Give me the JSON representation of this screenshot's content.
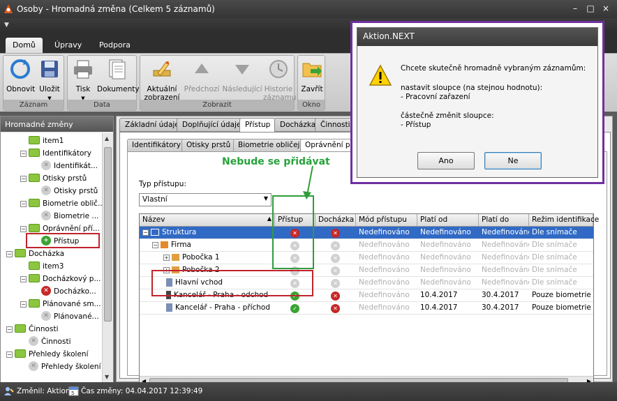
{
  "window": {
    "title": "Osoby - Hromadná změna (Celkem 5 záznamů)",
    "min": "–",
    "max": "□",
    "close": "×"
  },
  "ribbon_tabs": [
    "Domů",
    "Úpravy",
    "Podpora"
  ],
  "ribbon": {
    "groups": [
      "Záznam",
      "Data",
      "Zobrazit",
      "Okno"
    ],
    "buttons": {
      "obnovit": "Obnovit",
      "ulozit": "Uložit",
      "tisk": "Tisk",
      "dokumenty": "Dokumenty",
      "aktualni_1": "Aktuální",
      "aktualni_2": "zobrazení",
      "predchozi": "Předchozí",
      "nasledujici": "Následující",
      "historie_1": "Historie",
      "historie_2": "záznamu",
      "zavrit": "Zavřít"
    }
  },
  "left_panel": {
    "title": "Hromadné změny",
    "tree": [
      {
        "label": "item1"
      },
      {
        "label": "Identifikátory"
      },
      {
        "label": "Identifikát..."
      },
      {
        "label": "Otisky prstů"
      },
      {
        "label": "Otisky prstů"
      },
      {
        "label": "Biometrie oblič..."
      },
      {
        "label": "Biometrie ..."
      },
      {
        "label": "Oprávnění pří..."
      },
      {
        "label": "Přístup"
      },
      {
        "label": "Docházka"
      },
      {
        "label": "item3"
      },
      {
        "label": "Docházkový p..."
      },
      {
        "label": "Docházko..."
      },
      {
        "label": "Plánované sm..."
      },
      {
        "label": "Plánované..."
      },
      {
        "label": "Činnosti"
      },
      {
        "label": "Činnosti"
      },
      {
        "label": "Přehledy školení"
      },
      {
        "label": "Přehledy školení"
      }
    ]
  },
  "tabs": [
    "Základní údaje",
    "Doplňující údaje",
    "Přístup",
    "Docházka",
    "Činnosti"
  ],
  "subtabs": [
    "Identifikátory",
    "Otisky prstů",
    "Biometrie obličeje",
    "Oprávnění přístu"
  ],
  "access_type": {
    "label": "Typ přístupu:",
    "value": "Vlastní"
  },
  "annotation": "Nebude se přidávat",
  "grid": {
    "columns": [
      "Název",
      "Přístup",
      "Docházka",
      "Mód přístupu",
      "Platí od",
      "Platí do",
      "Režim identifikace"
    ],
    "rows": [
      {
        "name": "Struktura",
        "mode": "Nedefinováno",
        "from": "Nedefinováno",
        "to": "Nedefinováno",
        "ident": "Dle snímače"
      },
      {
        "name": "Firma",
        "mode": "Nedefinováno",
        "from": "Nedefinováno",
        "to": "Nedefinováno",
        "ident": "Dle snímače"
      },
      {
        "name": "Pobočka 1",
        "mode": "Nedefinováno",
        "from": "Nedefinováno",
        "to": "Nedefinováno",
        "ident": "Dle snímače"
      },
      {
        "name": "Pobočka 2",
        "mode": "Nedefinováno",
        "from": "Nedefinováno",
        "to": "Nedefinováno",
        "ident": "Dle snímače"
      },
      {
        "name": "Hlavní vchod",
        "mode": "Nedefinováno",
        "from": "Nedefinováno",
        "to": "Nedefinováno",
        "ident": "Dle snímače"
      },
      {
        "name": "Kancelář - Praha - odchod",
        "mode": "Nedefinováno",
        "from": "10.4.2017",
        "to": "30.4.2017",
        "ident": "Pouze biometrie"
      },
      {
        "name": "Kancelář - Praha - příchod",
        "mode": "Nedefinováno",
        "from": "10.4.2017",
        "to": "30.4.2017",
        "ident": "Pouze biometrie"
      }
    ]
  },
  "status": {
    "changed_by": "Změnil: Aktion",
    "changed_at": "Čas změny: 04.04.2017 12:39:49"
  },
  "dialog": {
    "title": "Aktion.NEXT",
    "line1": "Chcete skutečně hromadně vybraným záznamům:",
    "line2": "nastavit sloupce (na stejnou hodnotu):",
    "line3": "- Pracovní zařazení",
    "line4": "částečně změnit sloupce:",
    "line5": "- Přístup",
    "yes": "Ano",
    "no": "Ne"
  },
  "colors": {
    "selection": "#316ac5",
    "red_box": "#c0232c",
    "green_box": "#2f9c3a",
    "dialog_frame": "#7030a0",
    "ok_icon": "#3aa335",
    "deny_icon": "#c62828"
  }
}
